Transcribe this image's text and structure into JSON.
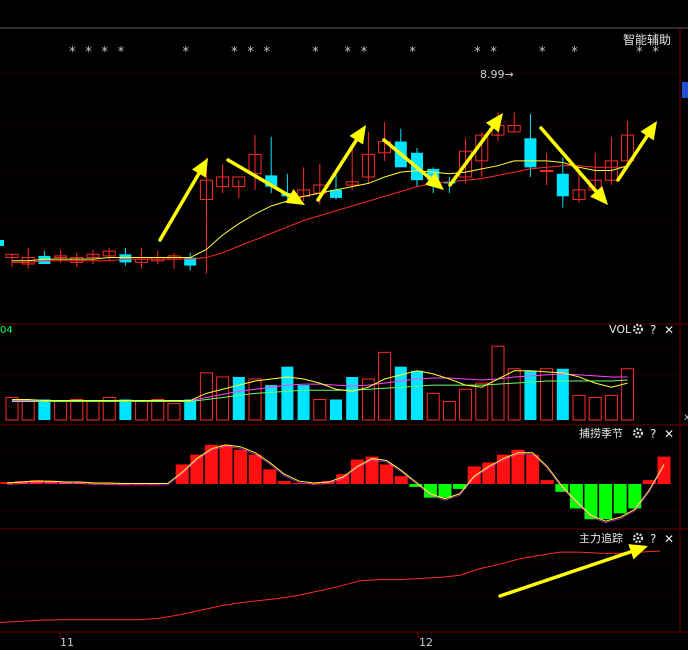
{
  "panels": {
    "main": {
      "title": "智能辅助",
      "stars": [
        "*",
        "*",
        "*",
        "*",
        "*",
        "*",
        "*",
        "*",
        "*",
        "*",
        "*",
        "*",
        "*",
        "*",
        "*",
        "*",
        "*",
        "*"
      ],
      "max_label": "8.99→"
    },
    "vol": {
      "title": "VOL",
      "left_label": "04"
    },
    "cycle": {
      "title": "捕捞季节"
    },
    "track": {
      "title": "主力追踪"
    }
  },
  "icons": {
    "settings": "gear-icon",
    "help": "?",
    "close": "✕"
  },
  "x_axis_labels": [
    "11",
    "12"
  ],
  "colors": {
    "up": "#ff2a2a",
    "down": "#00e5ff",
    "ma_fast": "#ffff33",
    "ma_slow": "#ff2a2a",
    "annot": "#ffff00",
    "grid": "#3a0000",
    "axis_text": "#c8c8c8",
    "vol_ma1": "#ffff33",
    "vol_ma2": "#ff44ff",
    "vol_ma3": "#66ff66",
    "cycle_pos": "#ff1010",
    "cycle_neg": "#00ff00"
  },
  "chart_data": [
    {
      "type": "candlestick",
      "title": "智能辅助",
      "x": [
        1,
        2,
        3,
        4,
        5,
        6,
        7,
        8,
        9,
        10,
        11,
        12,
        13,
        14,
        15,
        16,
        17,
        18,
        19,
        20,
        21,
        22,
        23,
        24,
        25,
        26,
        27,
        28,
        29,
        30,
        31,
        32,
        33,
        34,
        35,
        36,
        37,
        38,
        39
      ],
      "open": [
        8.1,
        8.06,
        8.11,
        8.1,
        8.07,
        8.1,
        8.11,
        8.12,
        8.07,
        8.08,
        8.09,
        8.1,
        8.46,
        8.54,
        8.54,
        8.62,
        8.61,
        8.5,
        8.48,
        8.5,
        8.52,
        8.55,
        8.6,
        8.75,
        8.82,
        8.75,
        8.65,
        8.57,
        8.6,
        8.7,
        8.86,
        8.88,
        8.84,
        8.64,
        8.62,
        8.46,
        8.52,
        8.58,
        8.7
      ],
      "high": [
        8.12,
        8.16,
        8.14,
        8.15,
        8.13,
        8.15,
        8.16,
        8.16,
        8.16,
        8.14,
        8.13,
        8.13,
        8.72,
        8.68,
        8.58,
        8.86,
        8.85,
        8.62,
        8.66,
        8.68,
        8.62,
        8.78,
        8.88,
        8.94,
        8.9,
        8.78,
        8.66,
        8.6,
        8.84,
        8.88,
        9.0,
        9.0,
        8.99,
        8.75,
        8.72,
        8.66,
        8.75,
        8.85,
        8.95
      ],
      "low": [
        8.04,
        8.03,
        8.06,
        8.07,
        8.04,
        8.06,
        8.08,
        8.05,
        8.03,
        8.06,
        8.03,
        8.02,
        8.0,
        8.5,
        8.47,
        8.52,
        8.5,
        8.46,
        8.45,
        8.43,
        8.46,
        8.52,
        8.56,
        8.7,
        8.72,
        8.54,
        8.5,
        8.5,
        8.56,
        8.6,
        8.82,
        8.88,
        8.6,
        8.55,
        8.41,
        8.44,
        8.52,
        8.55,
        8.68
      ],
      "close": [
        8.12,
        8.1,
        8.06,
        8.11,
        8.1,
        8.12,
        8.14,
        8.07,
        8.09,
        8.1,
        8.11,
        8.05,
        8.58,
        8.6,
        8.6,
        8.74,
        8.54,
        8.48,
        8.52,
        8.55,
        8.47,
        8.57,
        8.74,
        8.82,
        8.66,
        8.58,
        8.58,
        8.56,
        8.76,
        8.86,
        8.92,
        8.92,
        8.66,
        8.64,
        8.48,
        8.52,
        8.58,
        8.7,
        8.86
      ],
      "ma_fast": [
        8.08,
        8.08,
        8.09,
        8.09,
        8.09,
        8.09,
        8.1,
        8.1,
        8.1,
        8.1,
        8.1,
        8.1,
        8.15,
        8.24,
        8.31,
        8.37,
        8.42,
        8.45,
        8.48,
        8.5,
        8.52,
        8.54,
        8.56,
        8.6,
        8.63,
        8.64,
        8.63,
        8.62,
        8.63,
        8.65,
        8.67,
        8.7,
        8.7,
        8.7,
        8.69,
        8.66,
        8.64,
        8.64,
        8.67
      ],
      "ma_slow": [
        8.07,
        8.07,
        8.08,
        8.08,
        8.08,
        8.08,
        8.08,
        8.09,
        8.09,
        8.09,
        8.09,
        8.09,
        8.1,
        8.13,
        8.17,
        8.21,
        8.25,
        8.29,
        8.33,
        8.36,
        8.39,
        8.42,
        8.45,
        8.48,
        8.51,
        8.54,
        8.56,
        8.57,
        8.58,
        8.59,
        8.61,
        8.63,
        8.65,
        8.66,
        8.67,
        8.67,
        8.66,
        8.66,
        8.66
      ],
      "ylim": [
        7.7,
        9.45
      ]
    },
    {
      "type": "bar",
      "title": "VOL",
      "values": [
        22,
        18,
        20,
        18,
        20,
        18,
        22,
        20,
        18,
        20,
        16,
        20,
        46,
        42,
        42,
        40,
        34,
        52,
        34,
        20,
        20,
        42,
        40,
        66,
        52,
        48,
        26,
        18,
        30,
        36,
        72,
        50,
        48,
        50,
        50,
        24,
        22,
        24,
        50
      ],
      "up": [
        1,
        1,
        0,
        1,
        1,
        1,
        1,
        0,
        1,
        1,
        1,
        0,
        1,
        1,
        0,
        1,
        0,
        0,
        0,
        1,
        0,
        0,
        1,
        1,
        0,
        0,
        1,
        1,
        1,
        1,
        1,
        1,
        0,
        1,
        0,
        1,
        1,
        1,
        1
      ],
      "ma1": [
        20,
        20,
        19,
        19,
        19,
        19,
        19,
        19,
        19,
        19,
        19,
        19,
        26,
        30,
        34,
        38,
        40,
        42,
        40,
        36,
        30,
        28,
        32,
        40,
        44,
        48,
        45,
        40,
        34,
        32,
        40,
        48,
        48,
        47,
        46,
        42,
        36,
        32,
        36
      ],
      "ma2": [
        19,
        19,
        19,
        19,
        19,
        19,
        19,
        19,
        19,
        19,
        19,
        19,
        22,
        25,
        28,
        30,
        32,
        34,
        35,
        35,
        34,
        33,
        34,
        36,
        38,
        40,
        41,
        41,
        40,
        39,
        40,
        42,
        43,
        44,
        45,
        44,
        43,
        42,
        42
      ],
      "ma3": [
        18,
        18,
        18,
        18,
        18,
        18,
        18,
        18,
        18,
        18,
        18,
        18,
        20,
        22,
        24,
        26,
        27,
        28,
        29,
        29,
        29,
        29,
        30,
        31,
        32,
        33,
        34,
        34,
        34,
        34,
        35,
        36,
        37,
        38,
        38,
        38,
        38,
        38,
        39
      ],
      "ylim": [
        0,
        80
      ]
    },
    {
      "type": "bar",
      "title": "捕捞季节",
      "values": [
        2,
        3,
        4,
        3,
        2,
        2,
        1,
        0.5,
        0.5,
        0.5,
        0.5,
        0,
        20,
        30,
        40,
        40,
        35,
        30,
        15,
        3,
        1,
        1,
        3,
        10,
        25,
        28,
        20,
        8,
        -3,
        -14,
        -14,
        -5,
        18,
        22,
        30,
        35,
        30,
        4,
        -8,
        -25,
        -36,
        -36,
        -30,
        -25,
        4,
        28
      ],
      "line": [
        1,
        2,
        3,
        3,
        2,
        2,
        1,
        1,
        0.5,
        0.5,
        0.5,
        0.5,
        12,
        26,
        36,
        40,
        38,
        32,
        22,
        10,
        3,
        1,
        2,
        7,
        18,
        26,
        24,
        14,
        2,
        -10,
        -15,
        -10,
        8,
        18,
        26,
        32,
        32,
        18,
        -2,
        -18,
        -32,
        -38,
        -34,
        -26,
        -6,
        20
      ],
      "ylim": [
        -45,
        45
      ]
    },
    {
      "type": "line",
      "title": "主力追踪",
      "x": [
        0,
        20,
        40,
        60,
        80,
        100,
        120,
        140,
        160,
        180,
        200,
        220,
        240,
        260,
        280,
        300,
        320,
        340,
        360,
        380,
        400,
        420,
        440,
        460,
        480,
        500,
        520,
        540,
        560,
        580,
        600,
        620,
        640,
        660
      ],
      "y": [
        10,
        12,
        14,
        15,
        15,
        15,
        15,
        15,
        18,
        24,
        32,
        40,
        46,
        50,
        54,
        60,
        68,
        76,
        86,
        88,
        88,
        90,
        92,
        96,
        108,
        116,
        126,
        132,
        138,
        138,
        136,
        136,
        138,
        140
      ],
      "ylim": [
        0,
        160
      ]
    }
  ]
}
